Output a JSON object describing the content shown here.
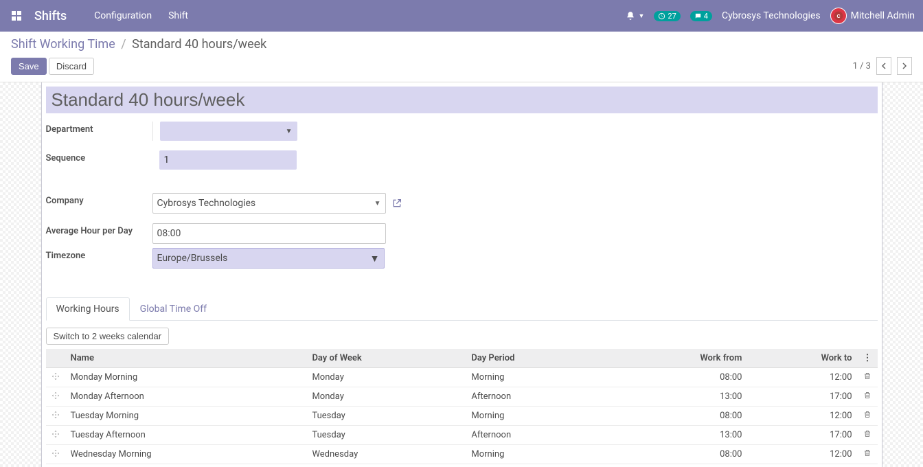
{
  "nav": {
    "brand": "Shifts",
    "menu": [
      "Configuration",
      "Shift"
    ],
    "clock_badge": "27",
    "chat_badge": "4",
    "company": "Cybrosys Technologies",
    "user": "Mitchell Admin"
  },
  "breadcrumb": {
    "parent": "Shift Working Time",
    "current": "Standard 40 hours/week"
  },
  "buttons": {
    "save": "Save",
    "discard": "Discard",
    "switch": "Switch to 2 weeks calendar"
  },
  "pager": {
    "value": "1 / 3"
  },
  "form": {
    "title": "Standard 40 hours/week",
    "labels": {
      "department": "Department",
      "sequence": "Sequence",
      "company": "Company",
      "avg": "Average Hour per Day",
      "tz": "Timezone"
    },
    "department": "",
    "sequence": "1",
    "company": "Cybrosys Technologies",
    "avg_hour": "08:00",
    "timezone": "Europe/Brussels"
  },
  "tabs": {
    "working": "Working Hours",
    "global": "Global Time Off"
  },
  "table": {
    "headers": {
      "name": "Name",
      "day": "Day of Week",
      "period": "Day Period",
      "from": "Work from",
      "to": "Work to"
    },
    "rows": [
      {
        "name": "Monday Morning",
        "day": "Monday",
        "period": "Morning",
        "from": "08:00",
        "to": "12:00"
      },
      {
        "name": "Monday Afternoon",
        "day": "Monday",
        "period": "Afternoon",
        "from": "13:00",
        "to": "17:00"
      },
      {
        "name": "Tuesday Morning",
        "day": "Tuesday",
        "period": "Morning",
        "from": "08:00",
        "to": "12:00"
      },
      {
        "name": "Tuesday Afternoon",
        "day": "Tuesday",
        "period": "Afternoon",
        "from": "13:00",
        "to": "17:00"
      },
      {
        "name": "Wednesday Morning",
        "day": "Wednesday",
        "period": "Morning",
        "from": "08:00",
        "to": "12:00"
      }
    ]
  }
}
